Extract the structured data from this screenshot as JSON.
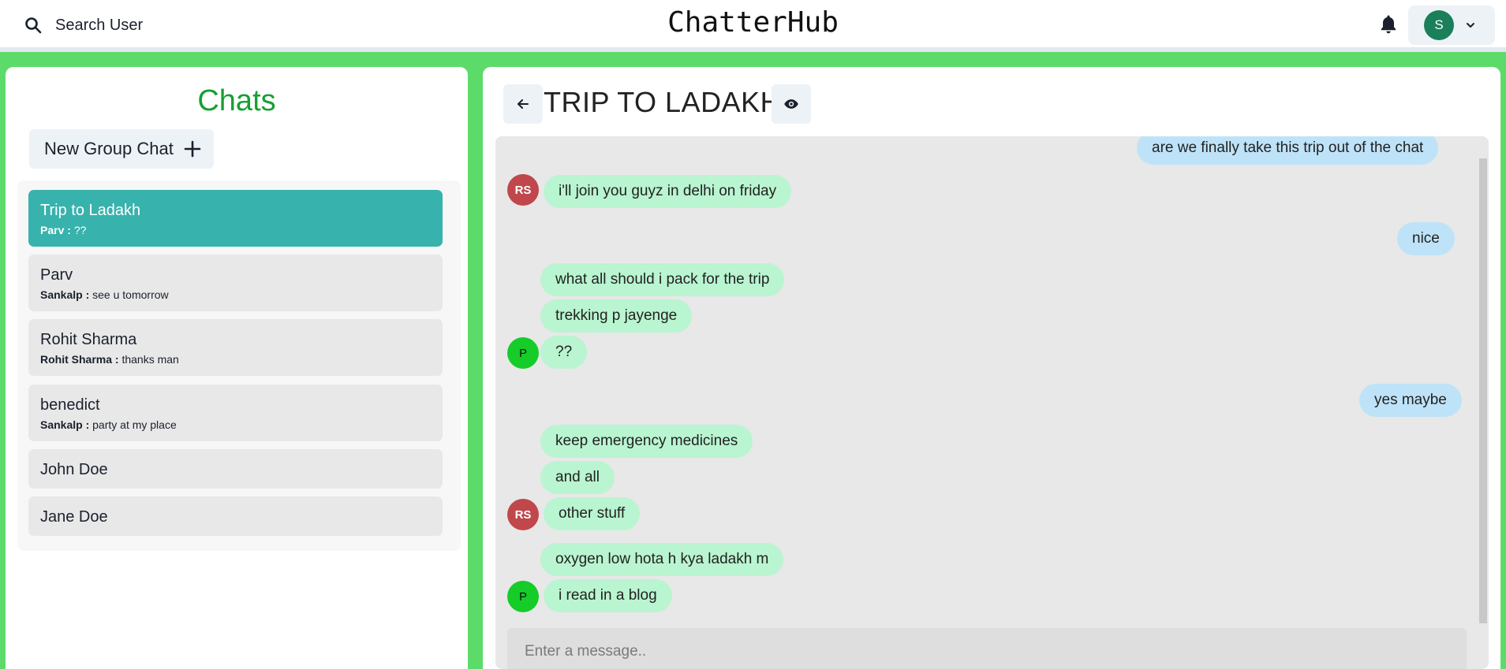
{
  "header": {
    "search_label": "Search User",
    "app_title": "ChatterHub",
    "profile_initial": "S"
  },
  "sidebar": {
    "title": "Chats",
    "new_group_label": "New Group Chat",
    "chats": [
      {
        "name": "Trip to Ladakh",
        "sender": "Parv :",
        "message": "??"
      },
      {
        "name": "Parv",
        "sender": "Sankalp :",
        "message": "see u tomorrow"
      },
      {
        "name": "Rohit Sharma",
        "sender": "Rohit Sharma :",
        "message": "thanks man"
      },
      {
        "name": "benedict",
        "sender": "Sankalp :",
        "message": "party at my place"
      },
      {
        "name": "John Doe"
      },
      {
        "name": "Jane Doe"
      }
    ]
  },
  "chat": {
    "title": "TRIP TO LADAKH",
    "input_placeholder": "Enter a message..",
    "messages": [
      {
        "text": "are we finally take this trip out of the chat",
        "direction": "out"
      },
      {
        "text": "i'll join you guyz in delhi on friday",
        "direction": "in",
        "avatar": "RS"
      },
      {
        "text": "nice",
        "direction": "out"
      },
      {
        "text": "what all should i pack for the trip",
        "direction": "in"
      },
      {
        "text": "trekking p jayenge",
        "direction": "in"
      },
      {
        "text": "??",
        "direction": "in",
        "avatar": "P"
      },
      {
        "text": "yes maybe",
        "direction": "out"
      },
      {
        "text": "keep emergency medicines",
        "direction": "in"
      },
      {
        "text": "and all",
        "direction": "in"
      },
      {
        "text": "other stuff",
        "direction": "in",
        "avatar": "RS"
      },
      {
        "text": "oxygen low hota h kya ladakh m",
        "direction": "in"
      },
      {
        "text": "i read in a blog",
        "direction": "in",
        "avatar": "P"
      }
    ]
  },
  "colors": {
    "background": "#5ddb6a",
    "active_chat": "#38b2ac",
    "incoming_bubble": "#b9f5d0",
    "outgoing_bubble": "#bee3f8",
    "chats_title": "#16a035"
  }
}
